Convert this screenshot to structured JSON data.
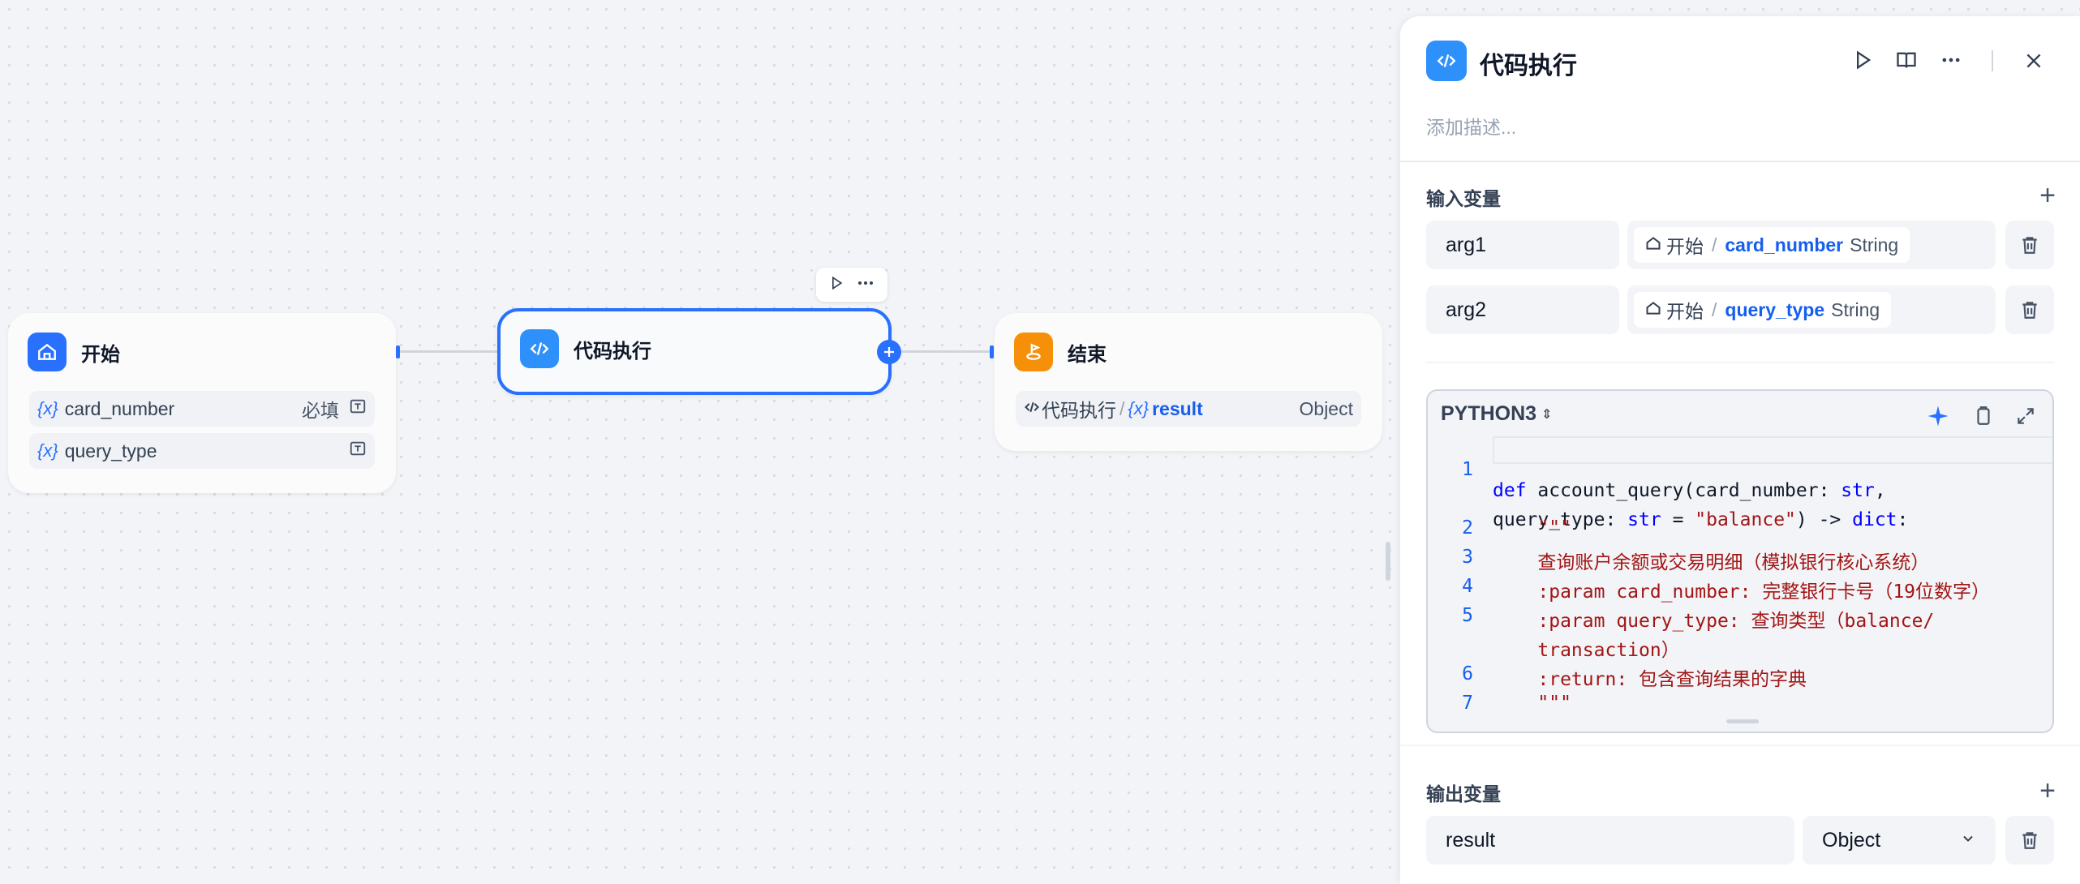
{
  "canvas": {
    "start_node": {
      "title": "开始",
      "vars": [
        {
          "name": "card_number",
          "required_label": "必填"
        },
        {
          "name": "query_type",
          "required_label": ""
        }
      ]
    },
    "code_node": {
      "title": "代码执行"
    },
    "end_node": {
      "title": "结束",
      "output": {
        "source": "代码执行",
        "var_name": "result",
        "type": "Object"
      }
    }
  },
  "panel": {
    "title": "代码执行",
    "description_placeholder": "添加描述...",
    "inputs_title": "输入变量",
    "inputs": [
      {
        "name": "arg1",
        "source": "开始",
        "var": "card_number",
        "type": "String"
      },
      {
        "name": "arg2",
        "source": "开始",
        "var": "query_type",
        "type": "String"
      }
    ],
    "code": {
      "language": "PYTHON3",
      "lines": [
        {
          "n": "1",
          "a": "def",
          "b": " account_query(card_number: ",
          "c": "str",
          "d": ","
        },
        {
          "n": "",
          "a": "",
          "b": "query_type: ",
          "c": "str",
          "d": " = ",
          "e": "\"balance\"",
          "f": ") -> ",
          "g": "dict",
          "h": ":"
        },
        {
          "n": "2",
          "doc": "    \"\"\""
        },
        {
          "n": "3",
          "doc": "    查询账户余额或交易明细（模拟银行核心系统）"
        },
        {
          "n": "4",
          "doc": "    :param card_number: 完整银行卡号（19位数字）"
        },
        {
          "n": "5",
          "doc": "    :param query_type: 查询类型（balance/"
        },
        {
          "n": "",
          "doc": "    transaction）"
        },
        {
          "n": "6",
          "doc": "    :return: 包含查询结果的字典"
        },
        {
          "n": "7",
          "doc": "    \"\"\""
        }
      ]
    },
    "outputs_title": "输出变量",
    "outputs": [
      {
        "name": "result",
        "type": "Object"
      }
    ]
  },
  "colors": {
    "accent": "#2970ff",
    "end": "#f79009",
    "bg": "#f2f4f7"
  }
}
